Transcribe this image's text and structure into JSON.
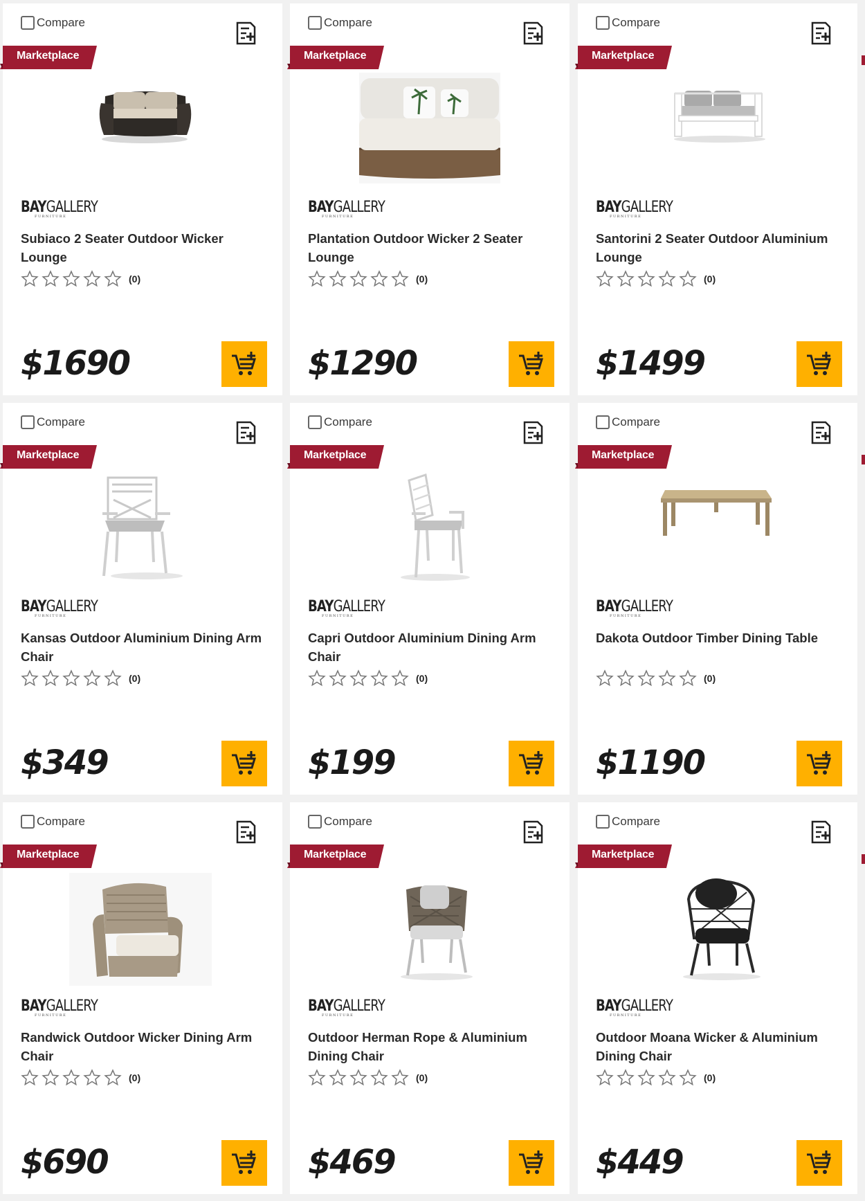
{
  "colors": {
    "badge": "#9e1b32",
    "cart_button": "#ffb000",
    "page_bg": "#f1f1f1",
    "card_bg": "#ffffff"
  },
  "products": [
    {
      "compare_label": "Compare",
      "badge": "Marketplace",
      "brand_bold": "BAY",
      "brand_light": "GALLERY",
      "brand_sub": "FURNITURE",
      "title": "Subiaco 2 Seater Outdoor Wicker Lounge",
      "rating": 0,
      "review_count": "(0)",
      "price": "$1690",
      "image": "dark-wicker-two-seater-sofa",
      "icons": [
        "checkbox-icon",
        "add-to-list-icon",
        "star-outline-icon",
        "add-to-cart-icon"
      ]
    },
    {
      "compare_label": "Compare",
      "badge": "Marketplace",
      "brand_bold": "BAY",
      "brand_light": "GALLERY",
      "brand_sub": "FURNITURE",
      "title": "Plantation Outdoor Wicker 2 Seater Lounge",
      "rating": 0,
      "review_count": "(0)",
      "price": "$1290",
      "image": "brown-wicker-sofa-palm-cushions"
    },
    {
      "compare_label": "Compare",
      "badge": "Marketplace",
      "brand_bold": "BAY",
      "brand_light": "GALLERY",
      "brand_sub": "FURNITURE",
      "title": "Santorini 2 Seater Outdoor Aluminium Lounge",
      "rating": 0,
      "review_count": "(0)",
      "price": "$1499",
      "image": "white-aluminium-sofa-grey-cushions"
    },
    {
      "compare_label": "Compare",
      "badge": "Marketplace",
      "brand_bold": "BAY",
      "brand_light": "GALLERY",
      "brand_sub": "FURNITURE",
      "title": "Kansas Outdoor Aluminium Dining Arm Chair",
      "rating": 0,
      "review_count": "(0)",
      "price": "$349",
      "image": "white-aluminium-cross-back-chair"
    },
    {
      "compare_label": "Compare",
      "badge": "Marketplace",
      "brand_bold": "BAY",
      "brand_light": "GALLERY",
      "brand_sub": "FURNITURE",
      "title": "Capri Outdoor Aluminium Dining Arm Chair",
      "rating": 0,
      "review_count": "(0)",
      "price": "$199",
      "image": "white-aluminium-slat-chair"
    },
    {
      "compare_label": "Compare",
      "badge": "Marketplace",
      "brand_bold": "BAY",
      "brand_light": "GALLERY",
      "brand_sub": "FURNITURE",
      "title": "Dakota Outdoor Timber Dining Table",
      "rating": 0,
      "review_count": "(0)",
      "price": "$1190",
      "image": "timber-dining-table"
    },
    {
      "compare_label": "Compare",
      "badge": "Marketplace",
      "brand_bold": "BAY",
      "brand_light": "GALLERY",
      "brand_sub": "FURNITURE",
      "title": "Randwick Outdoor Wicker Dining Arm Chair",
      "rating": 0,
      "review_count": "(0)",
      "price": "$690",
      "image": "beige-wicker-arm-chair"
    },
    {
      "compare_label": "Compare",
      "badge": "Marketplace",
      "brand_bold": "BAY",
      "brand_light": "GALLERY",
      "brand_sub": "FURNITURE",
      "title": "Outdoor Herman Rope & Aluminium Dining Chair",
      "rating": 0,
      "review_count": "(0)",
      "price": "$469",
      "image": "rope-dining-chair"
    },
    {
      "compare_label": "Compare",
      "badge": "Marketplace",
      "brand_bold": "BAY",
      "brand_light": "GALLERY",
      "brand_sub": "FURNITURE",
      "title": "Outdoor Moana Wicker & Aluminium Dining Chair",
      "rating": 0,
      "review_count": "(0)",
      "price": "$449",
      "image": "black-wicker-dining-chair"
    }
  ]
}
